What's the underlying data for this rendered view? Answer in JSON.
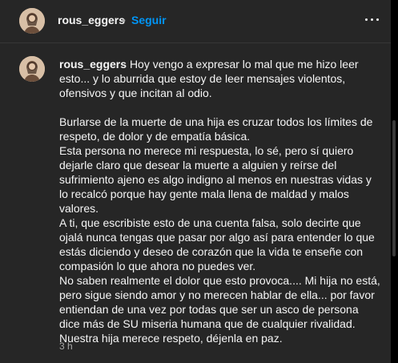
{
  "header": {
    "username": "rous_eggers",
    "separator": "•",
    "follow_label": "Seguir"
  },
  "comment": {
    "username": "rous_eggers",
    "intro": "Hoy vengo a expresar lo mal que me hizo leer esto... y lo aburrida que estoy de leer mensajes violentos, ofensivos y que incitan al odio.",
    "paragraphs": [
      "Burlarse de la muerte de una hija es cruzar todos los límites de respeto, de dolor y de empatía básica.",
      "Esta persona no merece mi respuesta, lo sé, pero sí quiero dejarle claro que desear la muerte a alguien y reírse del sufrimiento ajeno es algo indigno al menos en nuestras vidas y lo recalcó porque hay gente mala llena de maldad y malos valores.",
      "A ti, que escribiste esto de una cuenta falsa, solo decirte que ojalá nunca tengas que pasar por algo así para entender lo que estás diciendo y deseo de corazón que la vida te enseñe con compasión lo que ahora no puedes ver.",
      "No saben realmente el dolor que esto provoca.... Mi hija no está, pero sigue siendo amor y no merecen hablar de ella... por favor entiendan de una vez por todas que ser un asco de persona dice más de SU miseria humana que de cualquier rivalidad.",
      "Nuestra hija merece respeto, déjenla en paz."
    ],
    "timestamp": "3 h"
  },
  "colors": {
    "panel_bg": "#262626",
    "text": "#f5f5f5",
    "muted": "#a8a8a8",
    "accent": "#0095f6"
  },
  "icons": {
    "avatar": "profile-photo",
    "more": "more-options-icon"
  }
}
